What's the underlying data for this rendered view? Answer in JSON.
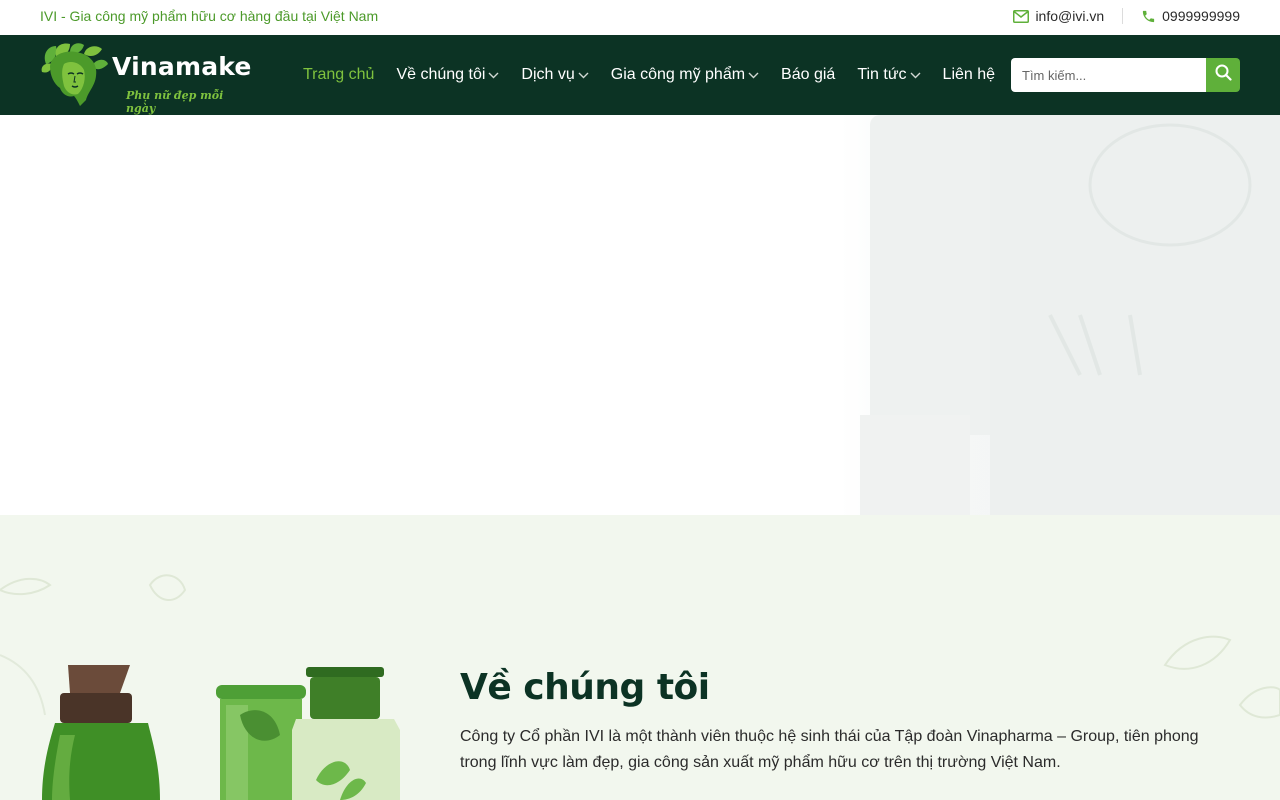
{
  "topbar": {
    "tagline": "IVI - Gia công mỹ phẩm hữu cơ hàng đầu tại Việt Nam",
    "email": "info@ivi.vn",
    "phone": "0999999999",
    "email_icon": "mail-icon",
    "phone_icon": "phone-icon"
  },
  "header": {
    "logo": {
      "wordmark": "Vinamake",
      "slogan": "Phụ nữ đẹp mỗi ngày"
    },
    "nav": [
      {
        "label": "Trang chủ",
        "active": true,
        "has_dropdown": false
      },
      {
        "label": "Về chúng tôi",
        "active": false,
        "has_dropdown": true
      },
      {
        "label": "Dịch vụ",
        "active": false,
        "has_dropdown": true
      },
      {
        "label": "Gia công mỹ phẩm",
        "active": false,
        "has_dropdown": true
      },
      {
        "label": "Báo giá",
        "active": false,
        "has_dropdown": false
      },
      {
        "label": "Tin tức",
        "active": false,
        "has_dropdown": true
      },
      {
        "label": "Liên hệ",
        "active": false,
        "has_dropdown": false
      }
    ],
    "search": {
      "placeholder": "Tìm kiếm...",
      "value": "",
      "button_icon": "search-icon"
    }
  },
  "about": {
    "title": "Về chúng tôi",
    "text": "Công ty Cổ phần IVI là một thành viên thuộc hệ sinh thái của Tập đoàn Vinapharma – Group, tiên phong trong lĩnh vực làm đẹp, gia công sản xuất mỹ phẩm hữu cơ trên thị trường Việt Nam."
  },
  "colors": {
    "header_bg": "#0c3324",
    "accent_green": "#7fc23e",
    "button_green": "#5fb03a",
    "tagline_green": "#4c9a2a",
    "section_bg": "#f2f7ee"
  }
}
